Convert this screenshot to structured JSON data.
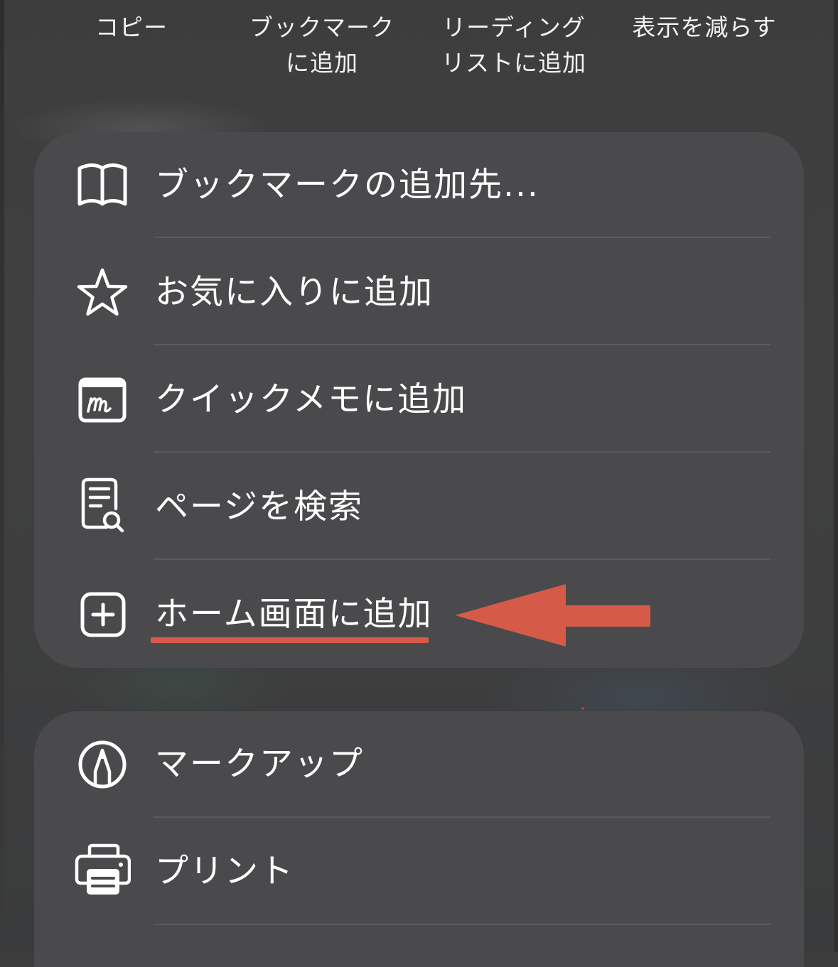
{
  "top_actions": [
    {
      "lines": [
        "コピー"
      ]
    },
    {
      "lines": [
        "ブックマーク",
        "に追加"
      ]
    },
    {
      "lines": [
        "リーディング",
        "リストに追加"
      ]
    },
    {
      "lines": [
        "表示を減らす"
      ]
    }
  ],
  "menu_group_1": [
    {
      "label": "ブックマークの追加先...",
      "icon": "book-icon"
    },
    {
      "label": "お気に入りに追加",
      "icon": "star-icon"
    },
    {
      "label": "クイックメモに追加",
      "icon": "quick-note-icon"
    },
    {
      "label": "ページを検索",
      "icon": "find-on-page-icon"
    },
    {
      "label": "ホーム画面に追加",
      "icon": "plus-square-icon"
    }
  ],
  "menu_group_2": [
    {
      "label": "マークアップ",
      "icon": "markup-pen-icon"
    },
    {
      "label": "プリント",
      "icon": "printer-icon"
    }
  ],
  "annotation": {
    "highlight_color": "#d65a48",
    "highlighted_item": "ホーム画面に追加"
  }
}
